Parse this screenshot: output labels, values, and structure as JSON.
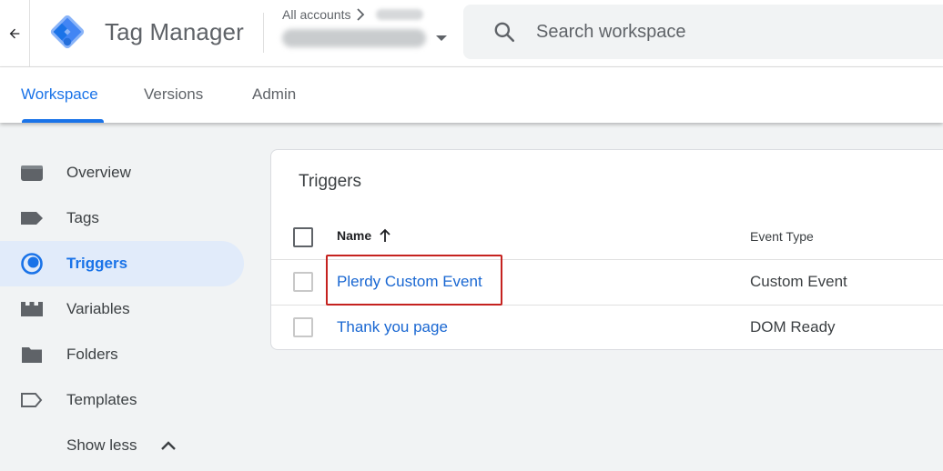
{
  "header": {
    "app_title": "Tag Manager",
    "accounts_label": "All accounts",
    "search_placeholder": "Search workspace"
  },
  "tabs": [
    {
      "label": "Workspace",
      "active": true
    },
    {
      "label": "Versions",
      "active": false
    },
    {
      "label": "Admin",
      "active": false
    }
  ],
  "sidebar": {
    "items": [
      {
        "label": "Overview",
        "icon": "overview-icon",
        "active": false
      },
      {
        "label": "Tags",
        "icon": "tag-icon",
        "active": false
      },
      {
        "label": "Triggers",
        "icon": "trigger-icon",
        "active": true
      },
      {
        "label": "Variables",
        "icon": "variables-icon",
        "active": false
      },
      {
        "label": "Folders",
        "icon": "folder-icon",
        "active": false
      },
      {
        "label": "Templates",
        "icon": "template-icon",
        "active": false
      }
    ],
    "show_less_label": "Show less"
  },
  "triggers_card": {
    "title": "Triggers",
    "columns": {
      "name": "Name",
      "event_type": "Event Type"
    },
    "rows": [
      {
        "name": "Plerdy Custom Event",
        "event_type": "Custom Event",
        "highlighted": true
      },
      {
        "name": "Thank you page",
        "event_type": "DOM Ready",
        "highlighted": false
      }
    ]
  },
  "colors": {
    "accent": "#1a73e8",
    "link": "#1967d2",
    "active_nav_bg": "#e1ebfa",
    "highlight_border": "#c5221f"
  }
}
